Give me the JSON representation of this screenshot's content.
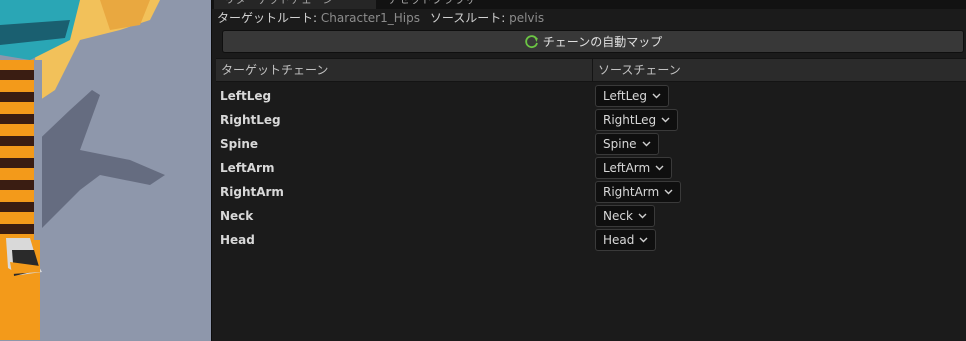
{
  "tabs": [
    {
      "label": "リターゲットチェーン",
      "active": true
    },
    {
      "label": "アセットブラウザ",
      "active": false
    }
  ],
  "roots": {
    "target_label": "ターゲットルート:",
    "target_value": "Character1_Hips",
    "source_label": "ソースルート:",
    "source_value": "pelvis"
  },
  "automap": {
    "label": "チェーンの自動マップ",
    "icon": "refresh-icon"
  },
  "columns": {
    "target": "ターゲットチェーン",
    "source": "ソースチェーン"
  },
  "chains": [
    {
      "target": "LeftLeg",
      "source": "LeftLeg"
    },
    {
      "target": "RightLeg",
      "source": "RightLeg"
    },
    {
      "target": "Spine",
      "source": "Spine"
    },
    {
      "target": "LeftArm",
      "source": "LeftArm"
    },
    {
      "target": "RightArm",
      "source": "RightArm"
    },
    {
      "target": "Neck",
      "source": "Neck"
    },
    {
      "target": "Head",
      "source": "Head"
    }
  ],
  "colors": {
    "panel_bg": "#1b1b1b",
    "header_bg": "#2b2b2b",
    "button_bg": "#383838",
    "accent_refresh": "#6cc644",
    "viewport_bg": "#8e97ab"
  }
}
